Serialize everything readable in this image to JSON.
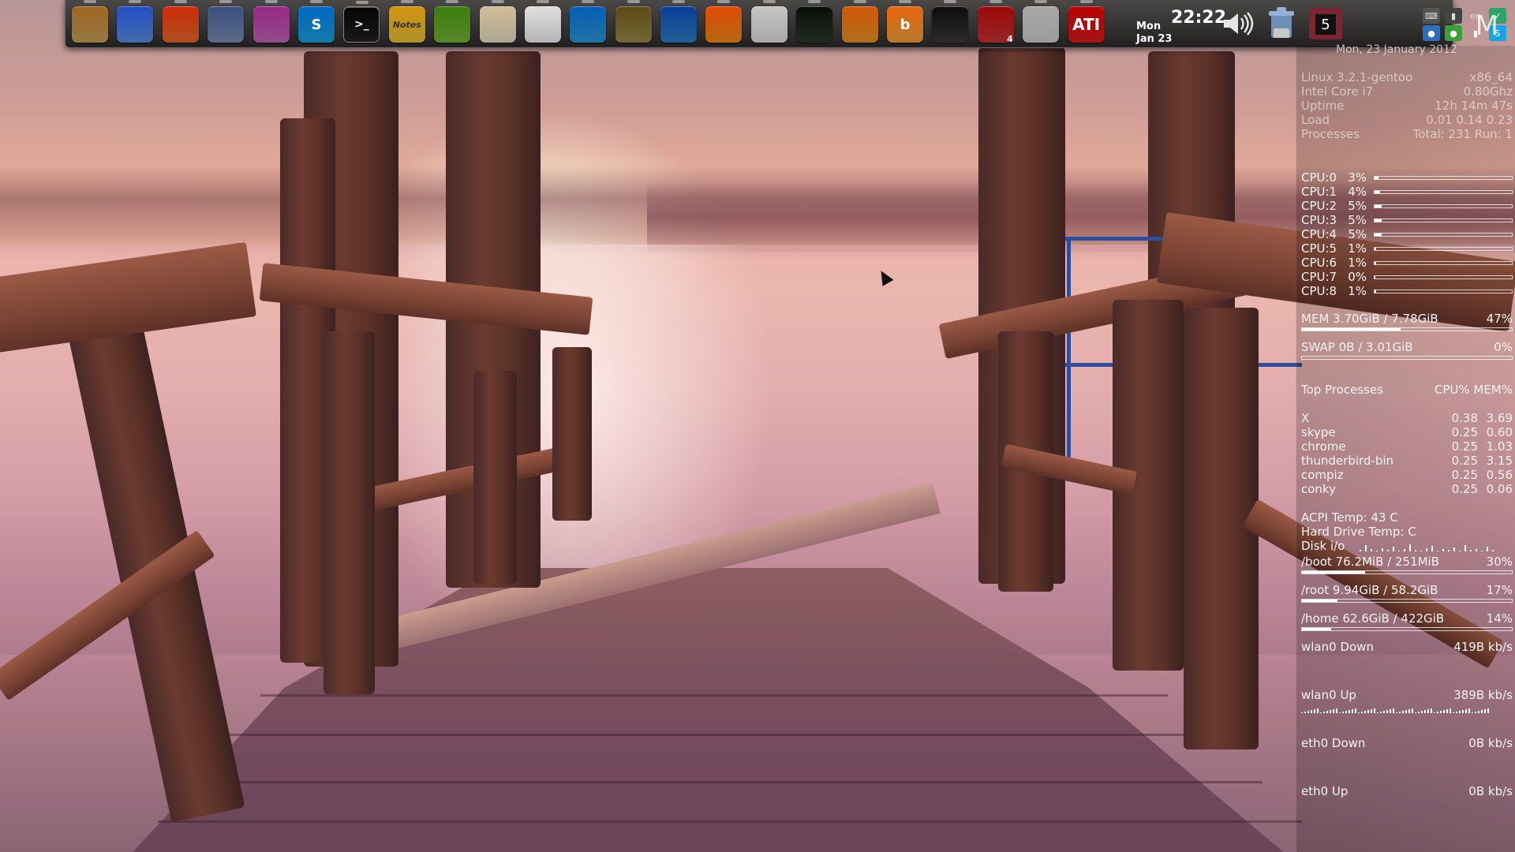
{
  "dock": {
    "apps": [
      {
        "name": "folder-icon",
        "glyph": "",
        "bg": "#c9a15c"
      },
      {
        "name": "chrome-icon",
        "glyph": "",
        "bg": "#5b8ee0"
      },
      {
        "name": "firefox-icon",
        "glyph": "",
        "bg": "#e66a2c"
      },
      {
        "name": "thunderbird-icon",
        "glyph": "",
        "bg": "#7a8fb4"
      },
      {
        "name": "chat-icon",
        "glyph": "",
        "bg": "#c565b8"
      },
      {
        "name": "skype-icon",
        "glyph": "S",
        "bg": "#1aa3e0"
      },
      {
        "name": "terminal-icon",
        "glyph": ">_",
        "bg": "#222"
      },
      {
        "name": "notes-icon",
        "glyph": "Notes",
        "bg": "#e8c23a"
      },
      {
        "name": "tools-icon",
        "glyph": "",
        "bg": "#7ab33b"
      },
      {
        "name": "text-editor-icon",
        "glyph": "",
        "bg": "#e6dcc4"
      },
      {
        "name": "document-icon",
        "glyph": "",
        "bg": "#efefef"
      },
      {
        "name": "system-monitor-icon",
        "glyph": "",
        "bg": "#2a9ad8"
      },
      {
        "name": "network-icon",
        "glyph": "",
        "bg": "#9a8a4a"
      },
      {
        "name": "refresh-icon",
        "glyph": "",
        "bg": "#2f7fc6"
      },
      {
        "name": "vlc-icon",
        "glyph": "",
        "bg": "#f08a1a"
      },
      {
        "name": "clipboard-icon",
        "glyph": "",
        "bg": "#e0e0e0"
      },
      {
        "name": "keyboard-icon",
        "glyph": "",
        "bg": "#2d3a2d"
      },
      {
        "name": "swirl-icon",
        "glyph": "",
        "bg": "#e79528"
      },
      {
        "name": "b-icon",
        "glyph": "b",
        "bg": "#f3a13b"
      },
      {
        "name": "disk-icon",
        "glyph": "",
        "bg": "#3a3a3a"
      },
      {
        "name": "calendar-icon",
        "glyph": "",
        "bg": "#c83232",
        "badge": "4"
      },
      {
        "name": "drawer-icon",
        "glyph": "",
        "bg": "#cfcfcf"
      },
      {
        "name": "ati-icon",
        "glyph": "ATI",
        "bg": "#d91c1c"
      }
    ],
    "clock": {
      "day": "Mon",
      "date": "Jan 23",
      "time": "22:22"
    },
    "cal_num": "5",
    "lang": "en"
  },
  "conky": {
    "date_header": "Mon, 23 January 2012",
    "big_letter": "M",
    "system": [
      {
        "label": "Linux 3.2.1-gentoo",
        "value": "x86_64"
      },
      {
        "label": "Intel Core i7",
        "value": "0.80Ghz"
      },
      {
        "label": "Uptime",
        "value": "12h 14m 47s"
      },
      {
        "label": "Load",
        "value": "0.01 0.14 0.23"
      },
      {
        "label": "Processes",
        "value": "Total: 231  Run: 1"
      }
    ],
    "cpus": [
      {
        "label": "CPU:0",
        "value": "3%",
        "pct": 3
      },
      {
        "label": "CPU:1",
        "value": "4%",
        "pct": 4
      },
      {
        "label": "CPU:2",
        "value": "5%",
        "pct": 5
      },
      {
        "label": "CPU:3",
        "value": "5%",
        "pct": 5
      },
      {
        "label": "CPU:4",
        "value": "5%",
        "pct": 5
      },
      {
        "label": "CPU:5",
        "value": "1%",
        "pct": 1
      },
      {
        "label": "CPU:6",
        "value": "1%",
        "pct": 1
      },
      {
        "label": "CPU:7",
        "value": "0%",
        "pct": 0
      },
      {
        "label": "CPU:8",
        "value": "1%",
        "pct": 1
      }
    ],
    "mem": {
      "label": "MEM",
      "value": "3.70GiB / 7.78GiB",
      "pct_text": "47%",
      "pct": 47
    },
    "swap": {
      "label": "SWAP",
      "value": "0B   / 3.01GiB",
      "pct_text": "0%",
      "pct": 0
    },
    "top_header": {
      "title": "Top Processes",
      "cols": "CPU% MEM%"
    },
    "processes": [
      {
        "name": "X",
        "cpu": "0.38",
        "mem": "3.69"
      },
      {
        "name": "skype",
        "cpu": "0.25",
        "mem": "0.60"
      },
      {
        "name": "chrome",
        "cpu": "0.25",
        "mem": "1.03"
      },
      {
        "name": "thunderbird-bin",
        "cpu": "0.25",
        "mem": "3.15"
      },
      {
        "name": "compiz",
        "cpu": "0.25",
        "mem": "0.56"
      },
      {
        "name": "conky",
        "cpu": "0.25",
        "mem": "0.06"
      }
    ],
    "acpi_temp": "ACPI Temp: 43 C",
    "hd_temp": "Hard Drive Temp: C",
    "disk_io": "Disk i/o",
    "filesystems": [
      {
        "label": "/boot",
        "value": "76.2MiB / 251MiB",
        "pct_text": "30%",
        "pct": 30
      },
      {
        "label": "/root",
        "value": "9.94GiB / 58.2GiB",
        "pct_text": "17%",
        "pct": 17
      },
      {
        "label": "/home",
        "value": "62.6GiB / 422GiB",
        "pct_text": "14%",
        "pct": 14
      }
    ],
    "network": [
      {
        "label": "wlan0 Down",
        "value": "419B",
        "unit": "kb/s"
      },
      {
        "label": "wlan0 Up",
        "value": "389B",
        "unit": "kb/s"
      },
      {
        "label": "eth0 Down",
        "value": "0B",
        "unit": "kb/s"
      },
      {
        "label": "eth0 Up",
        "value": "0B",
        "unit": "kb/s"
      }
    ]
  }
}
